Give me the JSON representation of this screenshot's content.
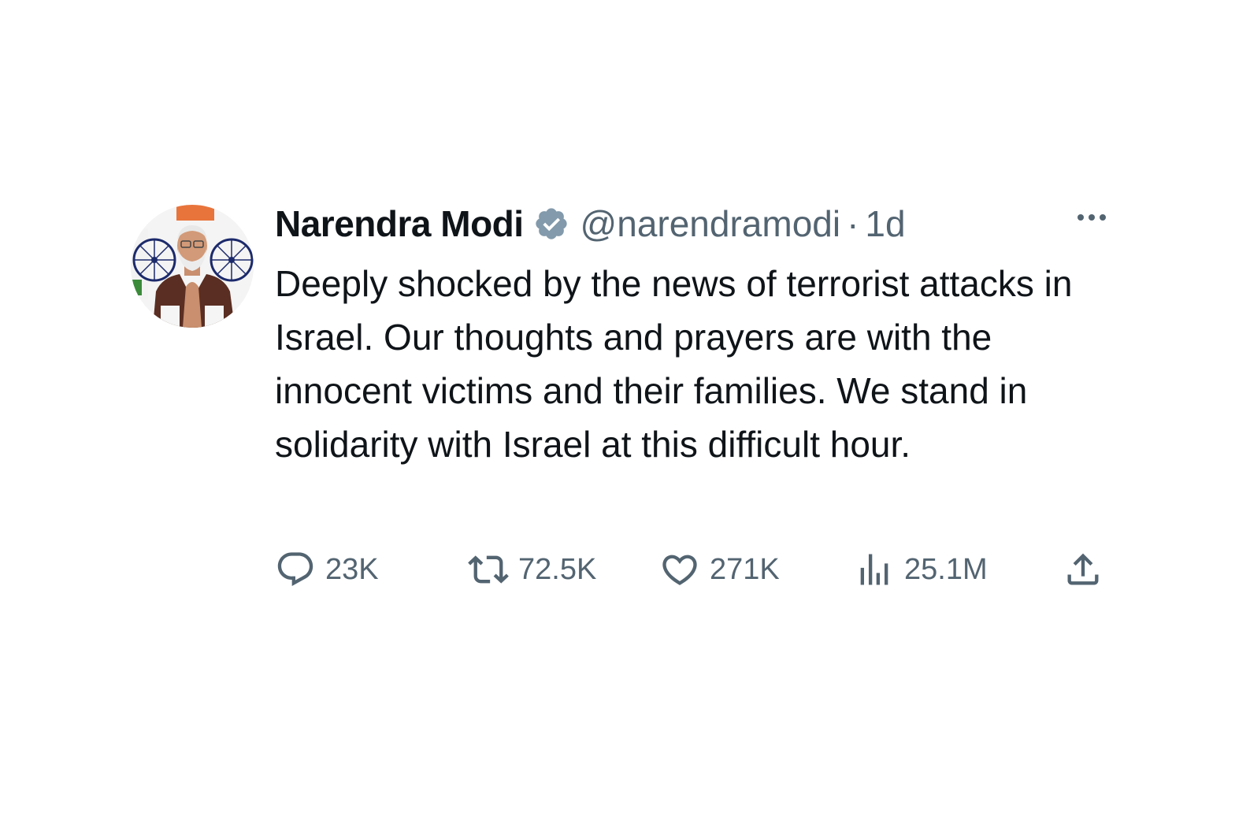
{
  "tweet": {
    "author_name": "Narendra Modi",
    "handle": "@narendramodi",
    "separator": "·",
    "time": "1d",
    "text": "Deeply shocked by the news of terrorist attacks in Israel. Our thoughts and prayers are with the innocent victims and their families. We stand in solidarity with Israel at this difficult hour.",
    "verified_icon": "verified-badge-icon",
    "verified_color": "#829aab"
  },
  "actions": {
    "replies": "23K",
    "retweets": "72.5K",
    "likes": "271K",
    "views": "25.1M"
  },
  "colors": {
    "text_primary": "#0f1419",
    "text_secondary": "#536471"
  }
}
